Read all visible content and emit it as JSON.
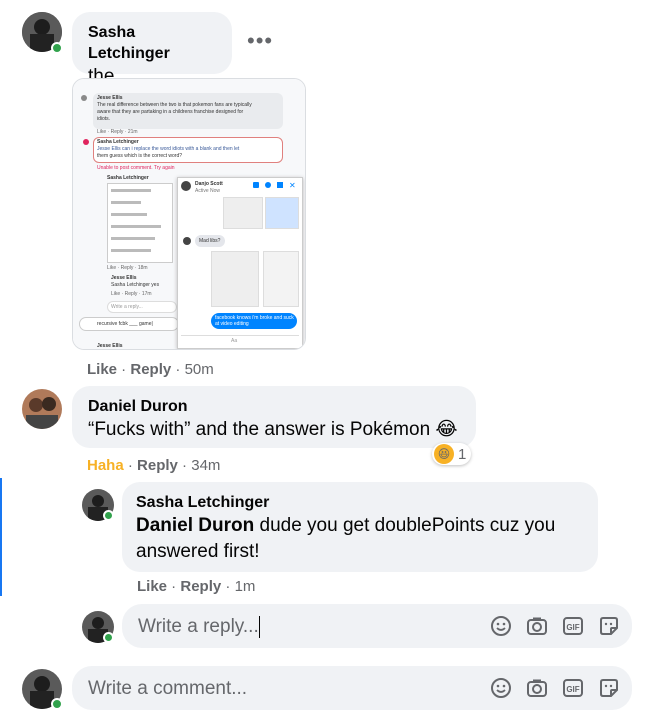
{
  "comment_1": {
    "author": "Sasha Letchinger",
    "text": "the",
    "menu_icon": "more-dots-icon",
    "like": "Like",
    "reply": "Reply",
    "time": "50m"
  },
  "embedded_screenshot": {
    "lines": [
      "Jesse Ellis",
      "The real difference between the two is that pokemon fans are typically",
      "aware that they are partaking in a childrens franchise designed for",
      "idiots.",
      "Like · Reply · 21m",
      "Sasha Letchinger",
      "Jesse Ellis can i replace the word idiots with a blank and then let",
      "them guess which is the correct word?",
      "Unable to post comment. Try again",
      "Sasha Letchinger",
      "Like · Reply · 18m",
      "Jesse Ellis",
      "Sasha Letchinger yes",
      "Like · Reply · 17m",
      "Write a reply...",
      "recursive fcbk ___ game|",
      "Jesse Ellis"
    ],
    "chat": {
      "name": "Danjo Scott",
      "status": "Active Now",
      "msg_1": "Mad libs?",
      "msg_2": "facebook knows i'm broke and suck at video editing",
      "input": "Aa"
    }
  },
  "comment_2": {
    "author": "Daniel Duron",
    "text": "“Fucks with” and the answer is Pokémon",
    "emoji": "😂",
    "reaction_label": "Haha",
    "reply": "Reply",
    "time": "34m",
    "reaction_count": "1"
  },
  "reply_1": {
    "author": "Sasha Letchinger",
    "mention": "Daniel Duron",
    "text": " dude you get doublePoints cuz you answered first!",
    "like": "Like",
    "reply": "Reply",
    "time": "1m"
  },
  "reply_composer": {
    "placeholder": "Write a reply..."
  },
  "comment_composer": {
    "placeholder": "Write a comment..."
  },
  "colors": {
    "online": "#31a24c",
    "accent": "#1877f2",
    "haha": "#f7b125",
    "bubble": "#f0f2f5"
  }
}
